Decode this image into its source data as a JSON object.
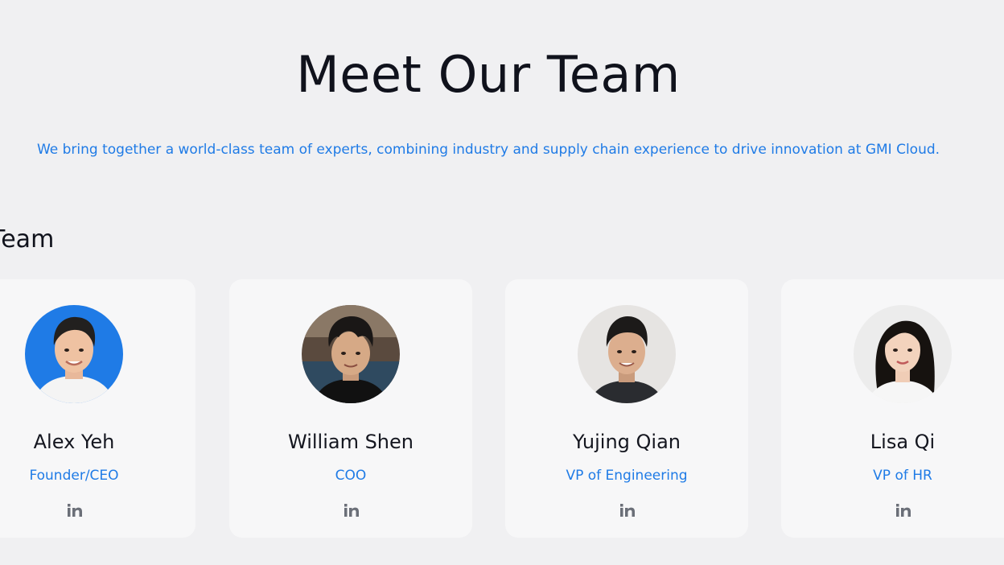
{
  "hero": {
    "title": "Meet Our Team",
    "subtitle": "We bring together a world-class team of experts, combining industry and supply chain experience to drive innovation at GMI Cloud."
  },
  "section": {
    "title": "Team"
  },
  "members": [
    {
      "name": "Alex Yeh",
      "role": "Founder/CEO",
      "avatar_bg": "#1f7be6",
      "social_icon": "linkedin-icon"
    },
    {
      "name": "William Shen",
      "role": "COO",
      "avatar_bg": "#3a3f4a",
      "social_icon": "linkedin-icon"
    },
    {
      "name": "Yujing Qian",
      "role": "VP of Engineering",
      "avatar_bg": "#e6e4e2",
      "social_icon": "linkedin-icon"
    },
    {
      "name": "Lisa Qi",
      "role": "VP of HR",
      "avatar_bg": "#ececec",
      "social_icon": "linkedin-icon"
    }
  ],
  "colors": {
    "accent": "#1f7be6",
    "background": "#f0f0f2",
    "card": "#f7f7f8",
    "text": "#10121c",
    "icon": "#6b6f78"
  }
}
